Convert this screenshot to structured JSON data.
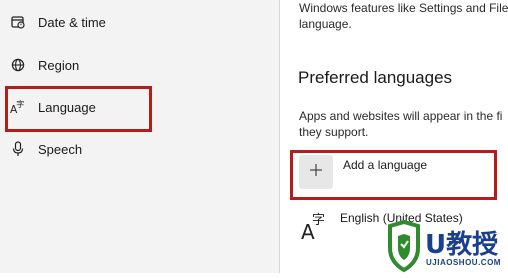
{
  "sidebar": {
    "items": [
      {
        "label": "Date & time",
        "icon": "calendar-clock-icon"
      },
      {
        "label": "Region",
        "icon": "globe-icon"
      },
      {
        "label": "Language",
        "icon": "language-icon"
      },
      {
        "label": "Speech",
        "icon": "microphone-icon"
      }
    ]
  },
  "main": {
    "intro_line1": "Windows features like Settings and File",
    "intro_line2": "language.",
    "section_title": "Preferred languages",
    "desc_line1": "Apps and websites will appear in the fi",
    "desc_line2": "they support.",
    "add_language_label": "Add a language",
    "add_icon": "plus-icon",
    "installed_language": "English (United States)",
    "installed_language_icon": "language-icon"
  },
  "watermark": {
    "brand": "U教授",
    "url": "UJIAOSHOU.COM"
  },
  "colors": {
    "highlight": "#b51c1c",
    "sidebar_bg": "#f3f3f3",
    "watermark_green": "#2e8b2e",
    "watermark_blue": "#1b3f8f"
  }
}
